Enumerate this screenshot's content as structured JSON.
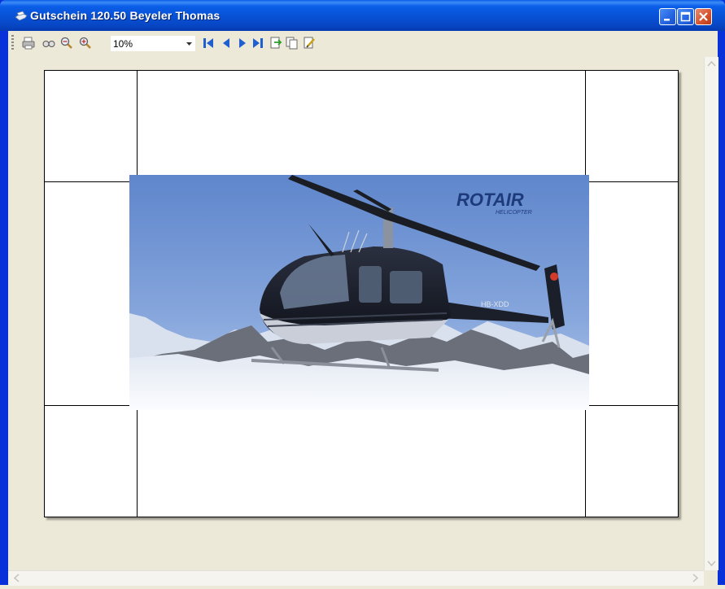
{
  "window": {
    "title": "Gutschein 120.50 Beyeler Thomas",
    "icon": "app-icon"
  },
  "toolbar": {
    "icons": [
      "print-icon",
      "page-setup-icon",
      "zoom-out-icon",
      "zoom-in-icon",
      "first-page-icon",
      "previous-page-icon",
      "next-page-icon",
      "last-page-icon",
      "export-icon",
      "copy-icon",
      "edit-icon"
    ],
    "zoom_value": "10%"
  },
  "document": {
    "logo_text": "ROTAIR",
    "logo_subtext": "HELICOPTER",
    "registration": "HB-XDD",
    "colors": {
      "sky": "#6a8fd0",
      "snow": "#f2f5fa",
      "helicopter": "#1a1d26",
      "logo": "#1d3a7a"
    }
  }
}
